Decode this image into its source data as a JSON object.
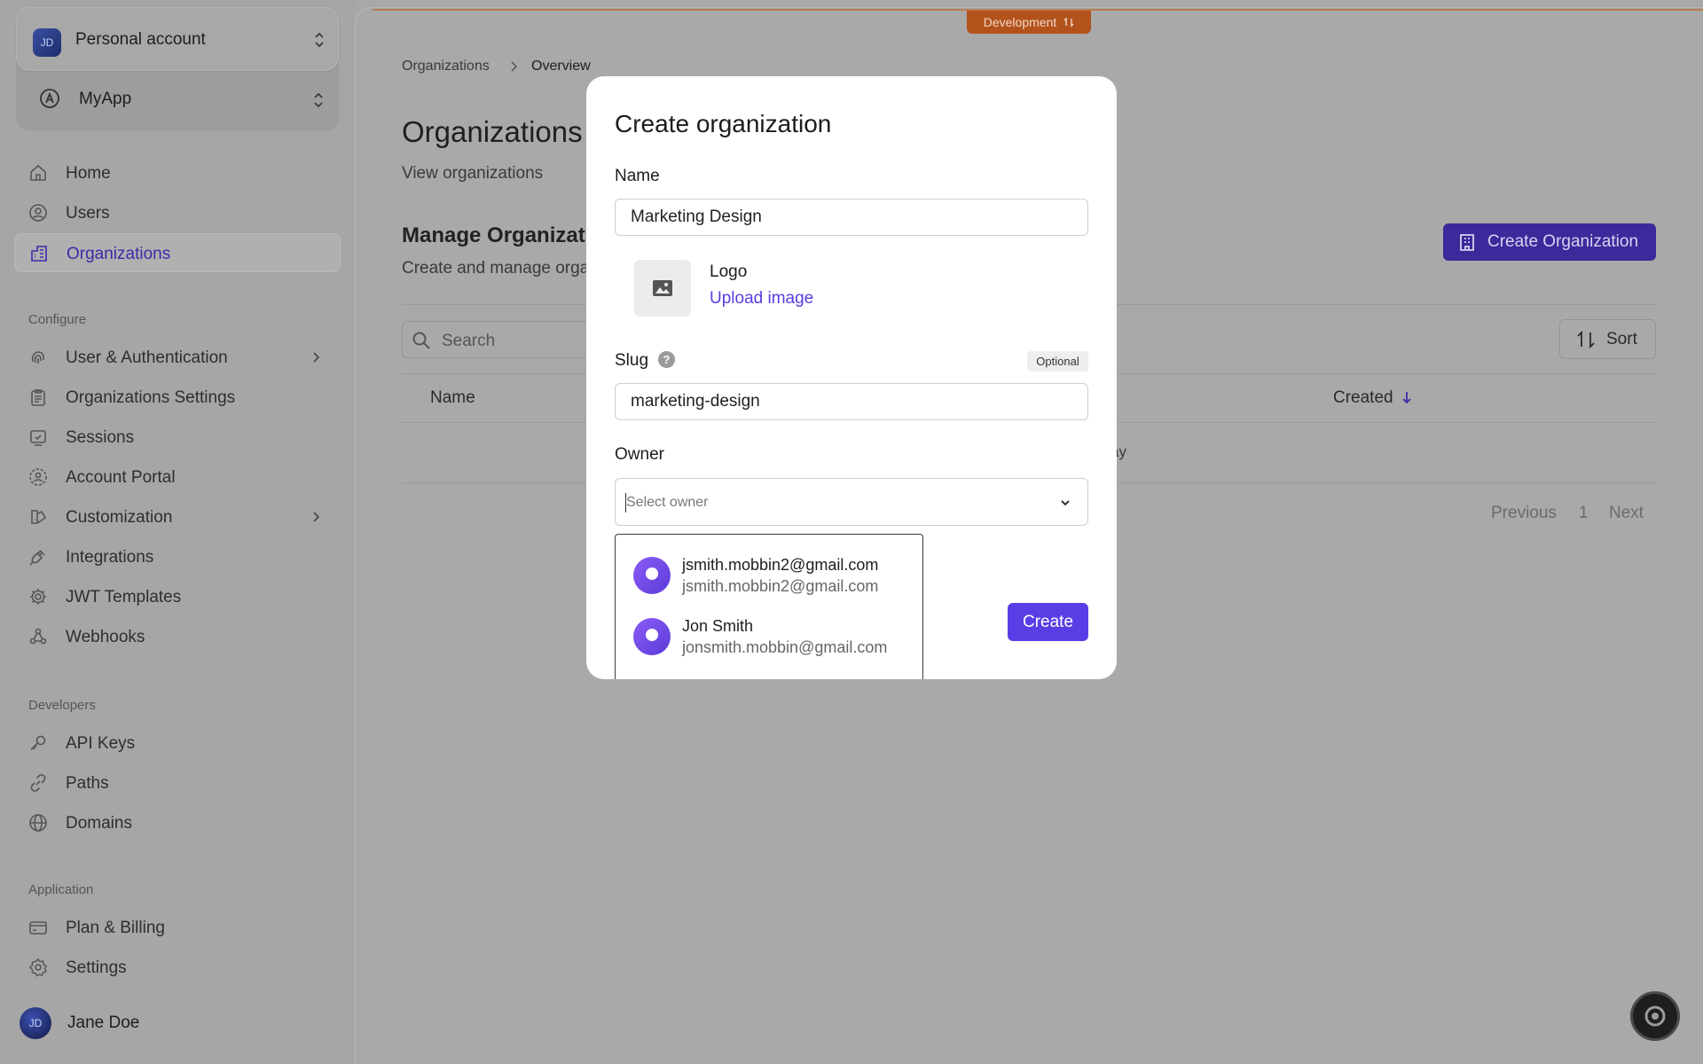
{
  "sidebar": {
    "account": {
      "initials": "JD",
      "name": "Personal account"
    },
    "app": {
      "name": "MyApp"
    },
    "main_items": [
      {
        "label": "Home",
        "icon": "home-icon"
      },
      {
        "label": "Users",
        "icon": "user-circle-icon"
      },
      {
        "label": "Organizations",
        "icon": "building-icon",
        "active": true
      }
    ],
    "configure": {
      "label": "Configure",
      "items": [
        {
          "label": "User & Authentication",
          "icon": "fingerprint-icon",
          "has_submenu": true
        },
        {
          "label": "Organizations Settings",
          "icon": "clipboard-icon"
        },
        {
          "label": "Sessions",
          "icon": "session-icon"
        },
        {
          "label": "Account Portal",
          "icon": "portal-icon"
        },
        {
          "label": "Customization",
          "icon": "palette-icon",
          "has_submenu": true
        },
        {
          "label": "Integrations",
          "icon": "plug-icon"
        },
        {
          "label": "JWT Templates",
          "icon": "gear-icon"
        },
        {
          "label": "Webhooks",
          "icon": "webhook-icon"
        }
      ]
    },
    "developers": {
      "label": "Developers",
      "items": [
        {
          "label": "API Keys",
          "icon": "key-icon"
        },
        {
          "label": "Paths",
          "icon": "link-icon"
        },
        {
          "label": "Domains",
          "icon": "globe-icon"
        }
      ]
    },
    "application": {
      "label": "Application",
      "items": [
        {
          "label": "Plan & Billing",
          "icon": "credit-card-icon"
        },
        {
          "label": "Settings",
          "icon": "settings-icon"
        }
      ]
    },
    "user": {
      "initials": "JD",
      "name": "Jane Doe"
    }
  },
  "environment_badge": "Development",
  "breadcrumb": {
    "parent": "Organizations",
    "current": "Overview"
  },
  "page": {
    "title": "Organizations",
    "subtitle": "View organizations",
    "section_title": "Manage Organizat",
    "section_subtitle": "Create and manage orga",
    "create_button": "Create Organization",
    "search_placeholder": "Search",
    "sort_label": "Sort",
    "table_headers": {
      "name": "Name",
      "created": "Created"
    },
    "row_fragment": "ay",
    "pagination": {
      "previous": "Previous",
      "page": "1",
      "next": "Next"
    }
  },
  "modal": {
    "title": "Create organization",
    "name_label": "Name",
    "name_value": "Marketing Design",
    "logo_label": "Logo",
    "upload_label": "Upload image",
    "slug_label": "Slug",
    "help_glyph": "?",
    "optional_label": "Optional",
    "slug_value": "marketing-design",
    "owner_label": "Owner",
    "owner_placeholder": "Select owner",
    "owner_options": [
      {
        "name": "jsmith.mobbin2@gmail.com",
        "email": "jsmith.mobbin2@gmail.com"
      },
      {
        "name": "Jon Smith",
        "email": "jonsmith.mobbin@gmail.com"
      }
    ],
    "create_label": "Create"
  },
  "colors": {
    "accent": "#5b3de6",
    "dimmed_accent": "#3a2a9b",
    "environment": "#b4521c"
  }
}
